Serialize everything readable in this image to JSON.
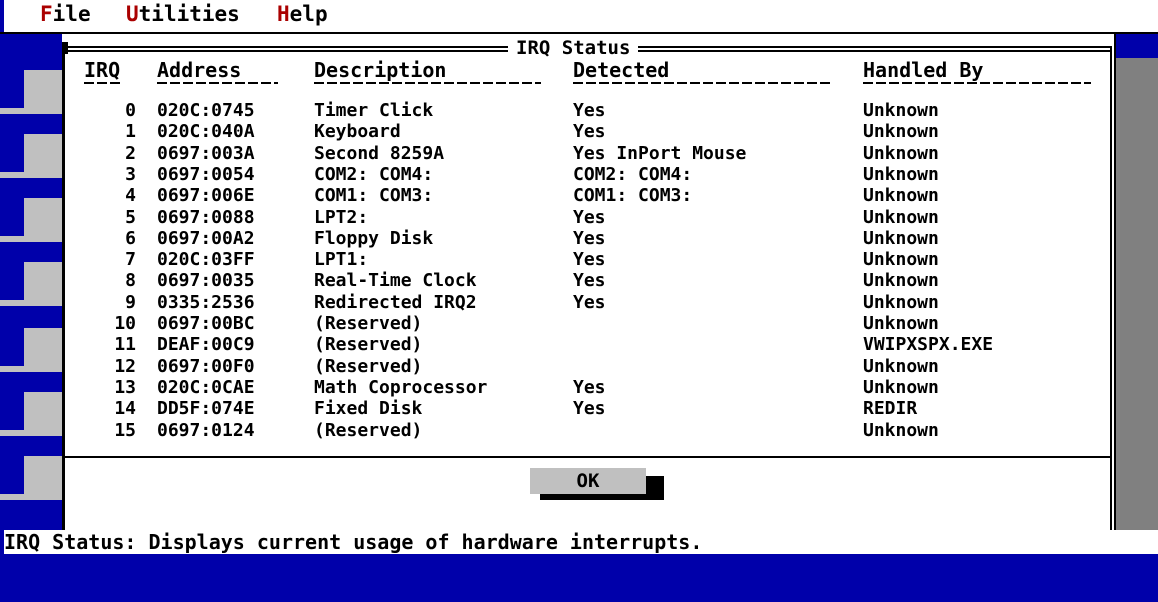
{
  "menu": [
    {
      "hot": "F",
      "rest": "ile"
    },
    {
      "hot": "U",
      "rest": "tilities"
    },
    {
      "hot": "H",
      "rest": "elp"
    }
  ],
  "dialog": {
    "title": "IRQ Status",
    "columns": [
      "IRQ",
      "Address",
      "Description",
      "Detected",
      "Handled By"
    ],
    "rows": [
      [
        "0",
        "020C:0745",
        "Timer Click",
        "Yes",
        "Unknown"
      ],
      [
        "1",
        "020C:040A",
        "Keyboard",
        "Yes",
        "Unknown"
      ],
      [
        "2",
        "0697:003A",
        "Second 8259A",
        "Yes InPort Mouse",
        "Unknown"
      ],
      [
        "3",
        "0697:0054",
        "COM2: COM4:",
        "COM2: COM4:",
        "Unknown"
      ],
      [
        "4",
        "0697:006E",
        "COM1: COM3:",
        "COM1: COM3:",
        "Unknown"
      ],
      [
        "5",
        "0697:0088",
        "LPT2:",
        "Yes",
        "Unknown"
      ],
      [
        "6",
        "0697:00A2",
        "Floppy Disk",
        "Yes",
        "Unknown"
      ],
      [
        "7",
        "020C:03FF",
        "LPT1:",
        "Yes",
        "Unknown"
      ],
      [
        "8",
        "0697:0035",
        "Real-Time Clock",
        "Yes",
        "Unknown"
      ],
      [
        "9",
        "0335:2536",
        "Redirected IRQ2",
        "Yes",
        "Unknown"
      ],
      [
        "10",
        "0697:00BC",
        "(Reserved)",
        "",
        "Unknown"
      ],
      [
        "11",
        "DEAF:00C9",
        "(Reserved)",
        "",
        "VWIPXSPX.EXE"
      ],
      [
        "12",
        "0697:00F0",
        "(Reserved)",
        "",
        "Unknown"
      ],
      [
        "13",
        "020C:0CAE",
        "Math Coprocessor",
        "Yes",
        "Unknown"
      ],
      [
        "14",
        "DD5F:074E",
        "Fixed Disk",
        "Yes",
        "REDIR"
      ],
      [
        "15",
        "0697:0124",
        "(Reserved)",
        "",
        "Unknown"
      ]
    ],
    "ok_label": "OK"
  },
  "status_text": "IRQ Status: Displays current usage of hardware interrupts.",
  "colors": {
    "desktop": "#0000aa",
    "dialog_bg": "#ffffff",
    "hotkey": "#aa0000",
    "button": "#c0c0c0",
    "scrollbar": "#808080"
  }
}
